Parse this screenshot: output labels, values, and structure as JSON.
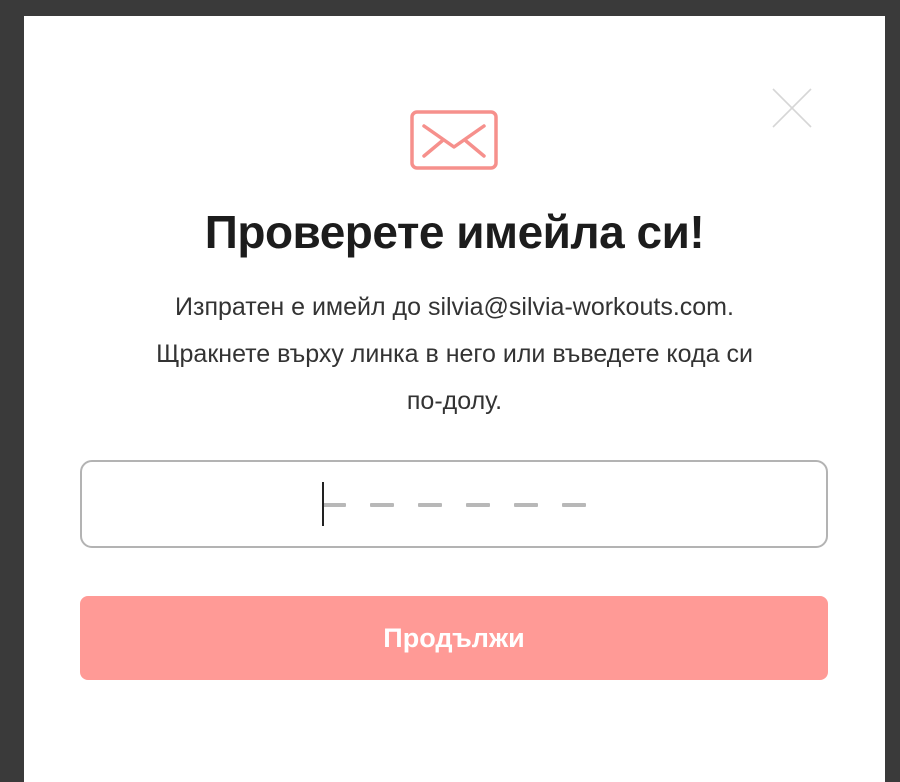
{
  "modal": {
    "title": "Проверете имейла си!",
    "description_lines": [
      "Изпратен е имейл до silvia@silvia-workouts.com.",
      "Щракнете върху линка в него или въведете кода си",
      "по-долу."
    ],
    "code_input": {
      "value": "",
      "length": 6
    },
    "continue_label": "Продължи",
    "icons": {
      "mail": "envelope-icon",
      "close": "close-icon"
    },
    "colors": {
      "accent": "#ff9a96",
      "icon": "#f6908c"
    }
  }
}
